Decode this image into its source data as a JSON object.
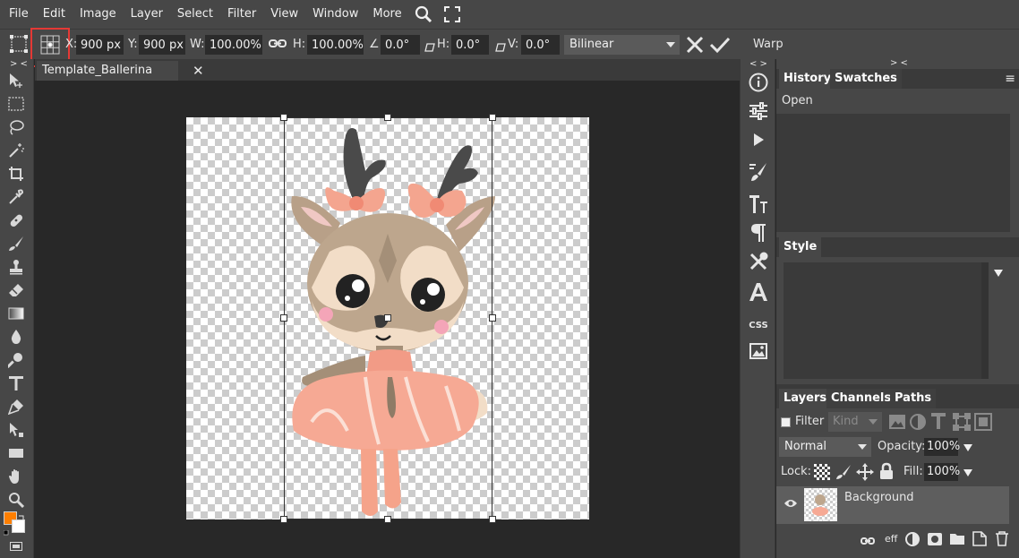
{
  "menu": {
    "items": [
      "File",
      "Edit",
      "Image",
      "Layer",
      "Select",
      "Filter",
      "View",
      "Window",
      "More"
    ]
  },
  "options": {
    "x_label": "X:",
    "x_value": "900 px",
    "y_label": "Y:",
    "y_value": "900 px",
    "w_label": "W:",
    "w_value": "100.00%",
    "h_label": "H:",
    "h_value": "100.00%",
    "angle_label": "∠:",
    "angle_value": "0.0°",
    "skew_h_label": "H:",
    "skew_h_value": "0.0°",
    "skew_v_label": "V:",
    "skew_v_value": "0.0°",
    "interpolation": "Bilinear",
    "warp_label": "Warp"
  },
  "document": {
    "tab_title": "Template_Ballerina",
    "close_glyph": "✕"
  },
  "panels": {
    "history_tab": "History",
    "swatches_tab": "Swatches",
    "history_items": [
      "Open"
    ],
    "style_tab": "Style",
    "layers_tab": "Layers",
    "channels_tab": "Channels",
    "paths_tab": "Paths",
    "filter_label": "Filter",
    "kind_placeholder": "Kind",
    "blend_mode": "Normal",
    "opacity_label": "Opacity:",
    "opacity_value": "100%",
    "lock_label": "Lock:",
    "fill_label": "Fill:",
    "fill_value": "100%",
    "layer_name": "Background",
    "eff_label": "eff",
    "collapse_left": "> <",
    "collapse_strip": "< >",
    "collapse_right": "> <",
    "menu_glyph": "≡"
  },
  "colors": {
    "foreground": "#ff7f00",
    "background": "#ffffff",
    "highlight_box": "#e53935"
  }
}
